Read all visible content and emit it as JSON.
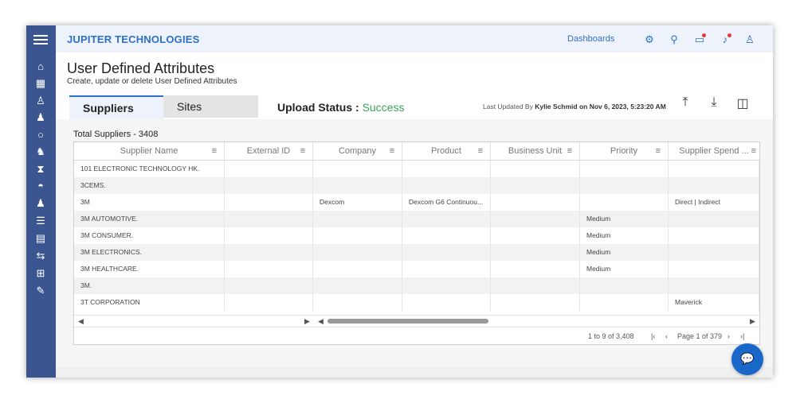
{
  "header": {
    "brand": "JUPITER TECHNOLOGIES",
    "dashboards_link": "Dashboards",
    "icons": [
      "settings-icon",
      "search-icon",
      "feedback-icon",
      "notification-icon",
      "user-icon"
    ]
  },
  "sidebar": {
    "icons": [
      "menu-icon",
      "home-icon",
      "calendar-icon",
      "org-icon",
      "group-icon",
      "cycle-icon",
      "search-person-icon",
      "hourglass-icon",
      "gauge-icon",
      "user-settings-icon",
      "list-icon",
      "clipboard-icon",
      "transfer-icon",
      "hierarchy-icon",
      "user-edit-icon"
    ]
  },
  "page": {
    "title": "User Defined Attributes",
    "subtitle": "Create, update or delete User Defined Attributes"
  },
  "tabs": [
    {
      "label": "Suppliers",
      "active": true
    },
    {
      "label": "Sites",
      "active": false
    }
  ],
  "upload": {
    "label": "Upload Status : ",
    "status": "Success",
    "status_color": "#3aa655"
  },
  "last_updated": {
    "prefix": "Last Updated By ",
    "user": "Kylie Schmid on Nov 6, 2023, 5:23:20 AM"
  },
  "total": "Total Suppliers - 3408",
  "grid": {
    "columns": [
      "Supplier Name",
      "External ID",
      "Company",
      "Product",
      "Business Unit",
      "Priority",
      "Supplier Spend ..."
    ],
    "rows": [
      [
        "101 ELECTRONIC TECHNOLOGY HK.",
        "",
        "",
        "",
        "",
        "",
        ""
      ],
      [
        "3CEMS.",
        "",
        "",
        "",
        "",
        "",
        ""
      ],
      [
        "3M",
        "",
        "Dexcom",
        "Dexcom G6 Continuou...",
        "",
        "",
        "Direct | Indirect"
      ],
      [
        "3M AUTOMOTIVE.",
        "",
        "",
        "",
        "",
        "Medium",
        ""
      ],
      [
        "3M CONSUMER.",
        "",
        "",
        "",
        "",
        "Medium",
        ""
      ],
      [
        "3M ELECTRONICS.",
        "",
        "",
        "",
        "",
        "Medium",
        ""
      ],
      [
        "3M HEALTHCARE.",
        "",
        "",
        "",
        "",
        "Medium",
        ""
      ],
      [
        "3M.",
        "",
        "",
        "",
        "",
        "",
        ""
      ],
      [
        "3T CORPORATION",
        "",
        "",
        "",
        "",
        "",
        "Maverick"
      ]
    ]
  },
  "pager": {
    "range": "1 to 9 of 3,408",
    "page": "Page 1 of 379"
  },
  "accent_color": "#2e6fc9",
  "sidebar_color": "#3b5590"
}
